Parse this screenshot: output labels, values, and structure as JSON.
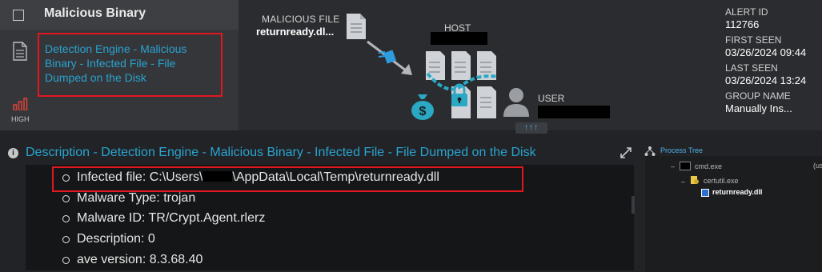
{
  "alert_list": {
    "title": "Malicious Binary",
    "item_name": "Detection Engine - Malicious Binary - Infected File - File Dumped on the Disk",
    "severity": "HIGH"
  },
  "diagram": {
    "malicious_file_label": "MALICIOUS FILE",
    "malicious_file_value": "returnready.dl...",
    "host_label": "HOST",
    "user_label": "USER",
    "expand_label": "↑↑↑"
  },
  "meta": {
    "alert_id_label": "ALERT ID",
    "alert_id": "112766",
    "first_seen_label": "FIRST SEEN",
    "first_seen": "03/26/2024 09:44",
    "last_seen_label": "LAST SEEN",
    "last_seen": "03/26/2024 13:24",
    "group_label": "GROUP NAME",
    "group": "Manually Ins..."
  },
  "description": {
    "title": "Description - Detection Engine - Malicious Binary - Infected File - File Dumped on the Disk",
    "infected_prefix": "Infected file: C:\\Users\\",
    "infected_suffix": "\\AppData\\Local\\Temp\\returnready.dll",
    "items": [
      "Malware Type: trojan",
      "Malware ID: TR/Crypt.Agent.rlerz",
      "Description: 0",
      "ave version: 8.3.68.40"
    ]
  },
  "process_tree": {
    "title": "Process Tree",
    "nodes": [
      "cmd.exe",
      "certutil.exe",
      "returnready.dll"
    ],
    "side_text": "(us"
  },
  "colors": {
    "accent": "#29a3cf",
    "highlight_border": "#e1171f",
    "severity": "#e0433b"
  }
}
